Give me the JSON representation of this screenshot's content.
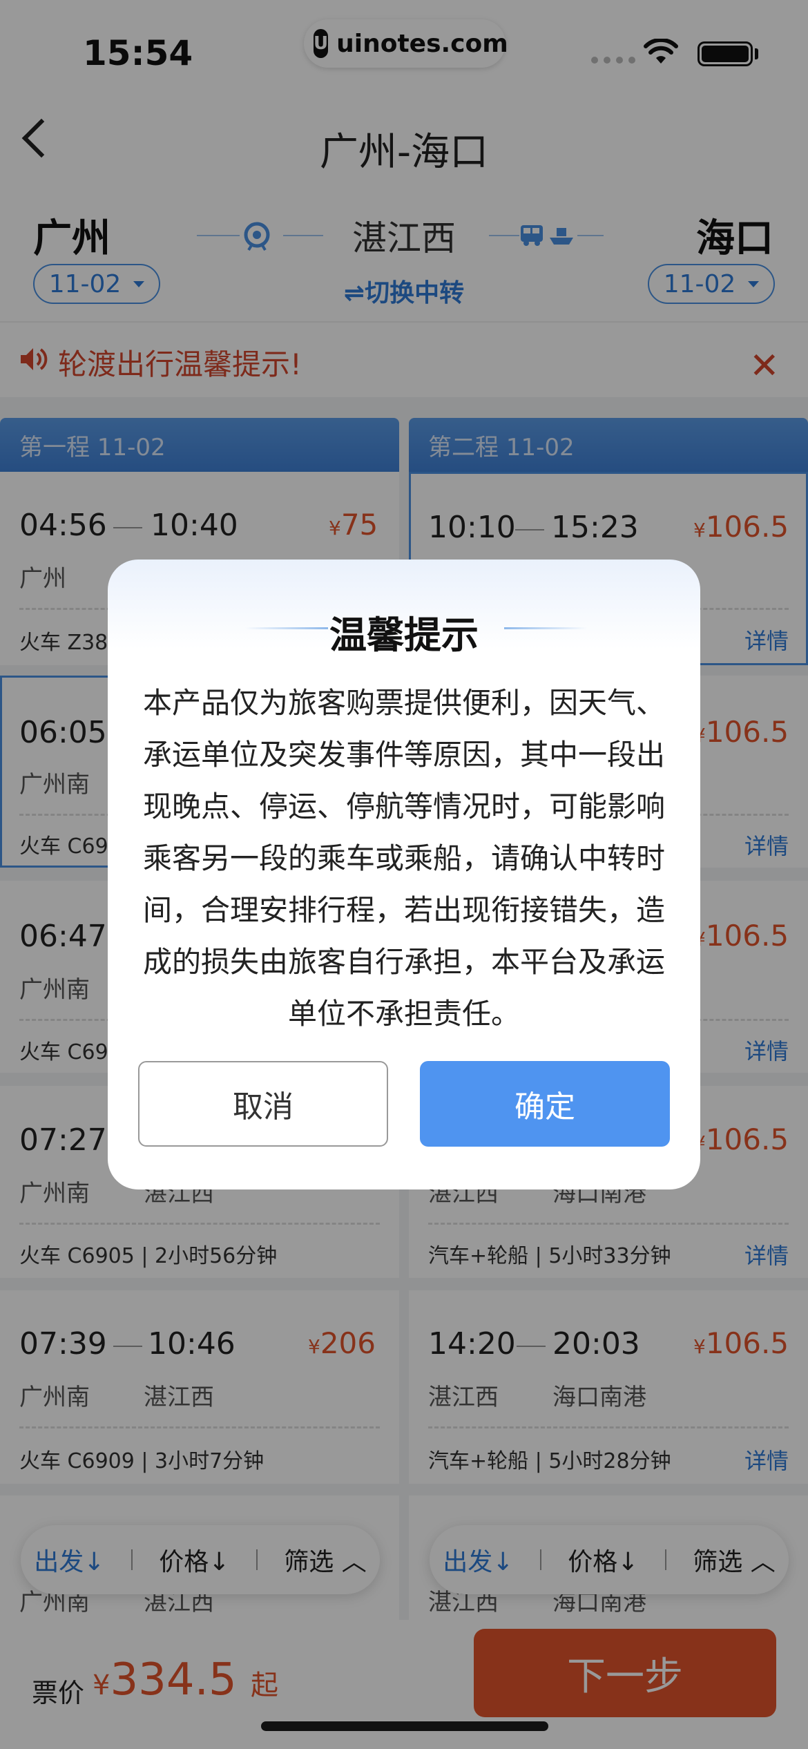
{
  "status_bar": {
    "time": "15:54",
    "site": "uinotes.com",
    "site_logo": "U"
  },
  "header": {
    "title": "广州-海口"
  },
  "route": {
    "from_city": "广州",
    "to_city": "海口",
    "transfer_city": "湛江西",
    "from_date": "11-02",
    "to_date": "11-02",
    "switch_label": "⇌切换中转"
  },
  "notice": {
    "text": "轮渡出行温馨提示!"
  },
  "leg1": {
    "header": "第一程  11-02",
    "cards": [
      {
        "dep": "04:56",
        "arr": "10:40",
        "price": "75",
        "from": "广州",
        "to": "",
        "info": "火车 Z38"
      },
      {
        "dep": "06:05",
        "arr": "",
        "price": "",
        "from": "广州南",
        "to": "",
        "info": "火车 C69"
      },
      {
        "dep": "06:47",
        "arr": "",
        "price": "",
        "from": "广州南",
        "to": "",
        "info": "火车 C69"
      },
      {
        "dep": "07:27",
        "arr": "",
        "price": "",
        "from": "广州南",
        "to": "湛江西",
        "info": "火车 C6905 | 2小时56分钟"
      },
      {
        "dep": "07:39",
        "arr": "10:46",
        "price": "206",
        "from": "广州南",
        "to": "湛江西",
        "info": "火车 C6909 | 3小时7分钟"
      },
      {
        "dep": "",
        "arr": "",
        "price": "",
        "from": "广州南",
        "to": "湛江西",
        "info": ""
      }
    ]
  },
  "leg2": {
    "header": "第二程  11-02",
    "cards": [
      {
        "dep": "10:10",
        "arr": "15:23",
        "price": "106.5",
        "from": "",
        "to": "",
        "info": "",
        "detail": "详情"
      },
      {
        "dep": "",
        "arr": "",
        "price": "106.5",
        "from": "",
        "to": "",
        "info": "",
        "detail": "详情"
      },
      {
        "dep": "",
        "arr": "",
        "price": "106.5",
        "from": "",
        "to": "",
        "info": "",
        "detail": "详情"
      },
      {
        "dep": "",
        "arr": "",
        "price": "106.5",
        "from": "湛江西",
        "to": "海口南港",
        "info": "汽车+轮船 | 5小时33分钟",
        "detail": "详情"
      },
      {
        "dep": "14:20",
        "arr": "20:03",
        "price": "106.5",
        "from": "湛江西",
        "to": "海口南港",
        "info": "汽车+轮船 | 5小时28分钟",
        "detail": "详情"
      },
      {
        "dep": "",
        "arr": "",
        "price": "",
        "from": "湛江西",
        "to": "海口南港",
        "info": "",
        "detail": ""
      }
    ]
  },
  "filters": {
    "depart": "出发↓",
    "price": "价格↓",
    "filter": "筛选"
  },
  "bottom": {
    "fare_label": "票价",
    "currency": "¥",
    "fare": "334.5",
    "suffix": "起",
    "next_label": "下一步"
  },
  "dialog": {
    "title": "温馨提示",
    "body": "本产品仅为旅客购票提供便利，因天气、承运单位及突发事件等原因，其中一段出现晚点、停运、停航等情况时，可能影响乘客另一段的乘车或乘船，请确认中转时间，合理安排行程，若出现衔接错失，造成的损失由旅客自行承担，本平台及承运单位不承担责任。",
    "cancel": "取消",
    "confirm": "确定"
  },
  "colors": {
    "accent": "#4f94f0",
    "price": "#e2542c",
    "notice": "#d2462e"
  }
}
